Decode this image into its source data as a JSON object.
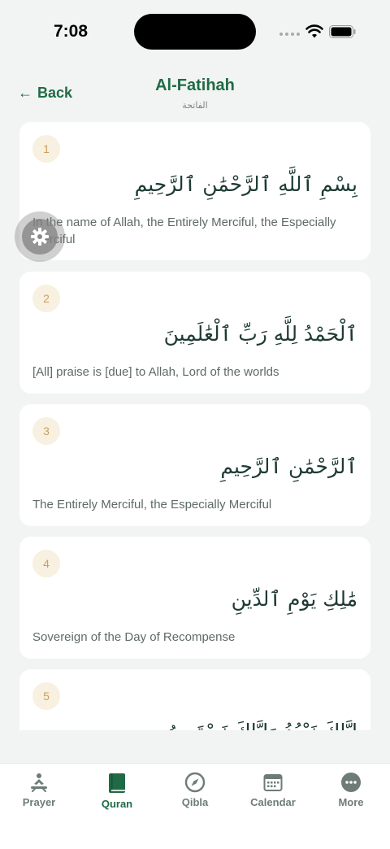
{
  "status": {
    "time": "7:08"
  },
  "header": {
    "back_label": "Back",
    "title": "Al-Fatihah",
    "subtitle": "الفاتحة"
  },
  "verses": [
    {
      "number": "1",
      "arabic": "بِسْمِ ٱللَّهِ ٱلرَّحْمَٰنِ ٱلرَّحِيمِ",
      "translation": "In the name of Allah, the Entirely Merciful, the Especially Merciful"
    },
    {
      "number": "2",
      "arabic": "ٱلْحَمْدُ لِلَّهِ رَبِّ ٱلْعَٰلَمِينَ",
      "translation": "[All] praise is [due] to Allah, Lord of the worlds"
    },
    {
      "number": "3",
      "arabic": "ٱلرَّحْمَٰنِ ٱلرَّحِيمِ",
      "translation": "The Entirely Merciful, the Especially Merciful"
    },
    {
      "number": "4",
      "arabic": "مَٰلِكِ يَوْمِ ٱلدِّينِ",
      "translation": "Sovereign of the Day of Recompense"
    },
    {
      "number": "5",
      "arabic": "إِيَّاكَ نَعْبُدُ وَإِيَّاكَ نَسْتَعِينُ",
      "translation": ""
    }
  ],
  "tabs": [
    {
      "label": "Prayer",
      "icon": "prayer-icon"
    },
    {
      "label": "Quran",
      "icon": "book-icon",
      "active": true
    },
    {
      "label": "Qibla",
      "icon": "compass-icon"
    },
    {
      "label": "Calendar",
      "icon": "calendar-icon"
    },
    {
      "label": "More",
      "icon": "more-icon"
    }
  ],
  "colors": {
    "accent": "#1f6b45",
    "badge_bg": "#f8f0e0",
    "badge_text": "#c9a15a",
    "background": "#f1f4f2"
  }
}
